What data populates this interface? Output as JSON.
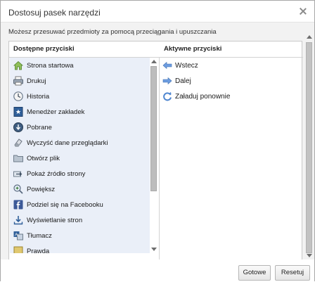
{
  "dialog": {
    "title": "Dostosuj pasek narzędzi",
    "instructions": "Możesz przesuwać przedmioty za pomocą przeciągania i upuszczania"
  },
  "available": {
    "header": "Dostępne przyciski",
    "items": [
      {
        "label": "Strona startowa",
        "icon": "home-icon"
      },
      {
        "label": "Drukuj",
        "icon": "printer-icon"
      },
      {
        "label": "Historia",
        "icon": "history-clock-icon"
      },
      {
        "label": "Menedżer zakładek",
        "icon": "bookmark-star-icon"
      },
      {
        "label": "Pobrane",
        "icon": "download-globe-icon"
      },
      {
        "label": "Wyczyść dane przeglądarki",
        "icon": "eraser-icon"
      },
      {
        "label": "Otwórz plik",
        "icon": "folder-icon"
      },
      {
        "label": "Pokaż źródło strony",
        "icon": "view-source-icon"
      },
      {
        "label": "Powiększ",
        "icon": "zoom-icon"
      },
      {
        "label": "Podziel się na Facebooku",
        "icon": "facebook-icon"
      },
      {
        "label": "Wyświetlanie stron",
        "icon": "page-display-icon"
      },
      {
        "label": "Tłumacz",
        "icon": "translate-icon"
      },
      {
        "label": "Prawda",
        "icon": "misc-icon"
      }
    ]
  },
  "active": {
    "header": "Aktywne przyciski",
    "items": [
      {
        "label": "Wstecz",
        "icon": "back-arrow-icon"
      },
      {
        "label": "Dalej",
        "icon": "forward-arrow-icon"
      },
      {
        "label": "Załaduj ponownie",
        "icon": "reload-icon"
      }
    ]
  },
  "footer": {
    "done_label": "Gotowe",
    "reset_label": "Resetuj"
  },
  "colors": {
    "list_bg": "#eaeff8",
    "arrow_blue": "#5b8fd6"
  }
}
